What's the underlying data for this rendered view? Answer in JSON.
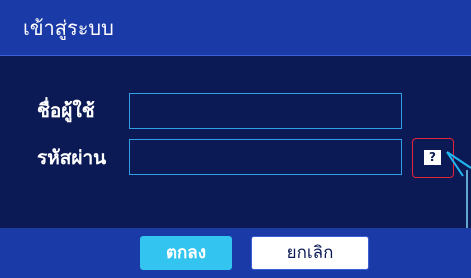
{
  "dialog": {
    "title": "เข้าสู่ระบบ"
  },
  "form": {
    "username_label": "ชื่อผู้ใช้",
    "username_value": "",
    "password_label": "รหัสผ่าน",
    "password_value": "",
    "help_icon": "question-mark-icon",
    "help_glyph": "?"
  },
  "buttons": {
    "ok_label": "ตกลง",
    "cancel_label": "ยกเลิก"
  },
  "colors": {
    "background": "#0b1a55",
    "title_bar": "#1a3aa7",
    "field_border": "#2f9fe6",
    "help_highlight": "#e3243a",
    "ok_button": "#33c4f0"
  }
}
